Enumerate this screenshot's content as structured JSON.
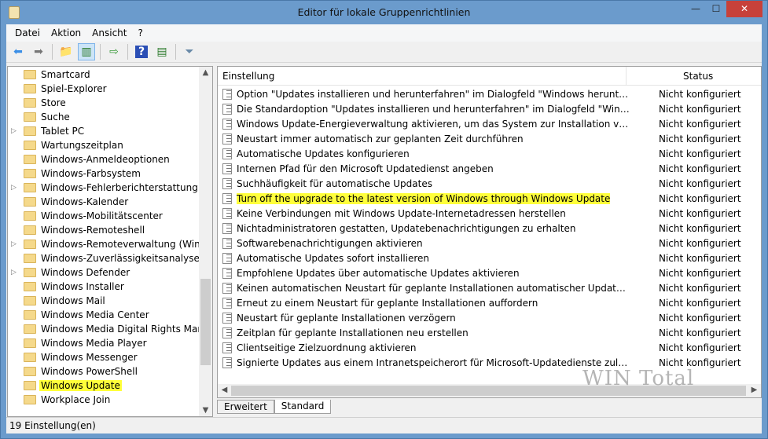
{
  "window": {
    "title": "Editor für lokale Gruppenrichtlinien",
    "minimize": "—",
    "maximize": "☐",
    "close": "✕"
  },
  "menu": [
    "Datei",
    "Aktion",
    "Ansicht",
    "?"
  ],
  "toolbar": [
    {
      "icon": "back-arrow-icon",
      "glyph": "⬅",
      "color": "#3a8ee6"
    },
    {
      "icon": "forward-arrow-icon",
      "glyph": "➡",
      "color": "#777"
    },
    {
      "icon": "up-folder-icon",
      "glyph": "📁",
      "color": "#d9b45a"
    },
    {
      "icon": "show-hide-tree-icon",
      "glyph": "▥",
      "color": "#2a7a2a",
      "active": true
    },
    {
      "icon": "export-list-icon",
      "glyph": "⇨",
      "color": "#3a9a3a"
    },
    {
      "icon": "help-icon",
      "glyph": "?",
      "color": "#fff"
    },
    {
      "icon": "action-pane-icon",
      "glyph": "▤",
      "color": "#2a7a2a"
    },
    {
      "icon": "filter-icon",
      "glyph": "⏷",
      "color": "#6a8aa8"
    }
  ],
  "tree": [
    {
      "label": "Smartcard"
    },
    {
      "label": "Spiel-Explorer"
    },
    {
      "label": "Store"
    },
    {
      "label": "Suche"
    },
    {
      "label": "Tablet PC",
      "expandable": true
    },
    {
      "label": "Wartungszeitplan"
    },
    {
      "label": "Windows-Anmeldeoptionen"
    },
    {
      "label": "Windows-Farbsystem"
    },
    {
      "label": "Windows-Fehlerberichterstattung",
      "expandable": true
    },
    {
      "label": "Windows-Kalender"
    },
    {
      "label": "Windows-Mobilitätscenter"
    },
    {
      "label": "Windows-Remoteshell"
    },
    {
      "label": "Windows-Remoteverwaltung (Window",
      "expandable": true
    },
    {
      "label": "Windows-Zuverlässigkeitsanalyse"
    },
    {
      "label": "Windows Defender",
      "expandable": true
    },
    {
      "label": "Windows Installer"
    },
    {
      "label": "Windows Mail"
    },
    {
      "label": "Windows Media Center"
    },
    {
      "label": "Windows Media Digital Rights Manage"
    },
    {
      "label": "Windows Media Player"
    },
    {
      "label": "Windows Messenger"
    },
    {
      "label": "Windows PowerShell"
    },
    {
      "label": "Windows Update",
      "selected": true
    },
    {
      "label": "Workplace Join"
    }
  ],
  "list": {
    "col_setting": "Einstellung",
    "col_status": "Status",
    "rows": [
      {
        "name": "Option \"Updates installieren und herunterfahren\" im Dialogfeld \"Windows herunterfahren\" nicht anzeigen",
        "status": "Nicht konfiguriert"
      },
      {
        "name": "Die Standardoption \"Updates installieren und herunterfahren\" im Dialogfeld \"Windows herunterfahren\" nicht anpassen",
        "status": "Nicht konfiguriert"
      },
      {
        "name": "Windows Update-Energieverwaltung aktivieren, um das System zur Installation von geplanten Updates zu reaktivieren",
        "status": "Nicht konfiguriert"
      },
      {
        "name": "Neustart immer automatisch zur geplanten Zeit durchführen",
        "status": "Nicht konfiguriert"
      },
      {
        "name": "Automatische Updates konfigurieren",
        "status": "Nicht konfiguriert"
      },
      {
        "name": "Internen Pfad für den Microsoft Updatedienst angeben",
        "status": "Nicht konfiguriert"
      },
      {
        "name": "Suchhäufigkeit für automatische Updates",
        "status": "Nicht konfiguriert"
      },
      {
        "name": "Turn off the upgrade to the latest version of Windows through Windows Update",
        "status": "Nicht konfiguriert",
        "highlighted": true
      },
      {
        "name": "Keine Verbindungen mit Windows Update-Internetadressen herstellen",
        "status": "Nicht konfiguriert"
      },
      {
        "name": "Nichtadministratoren gestatten, Updatebenachrichtigungen zu erhalten",
        "status": "Nicht konfiguriert"
      },
      {
        "name": "Softwarebenachrichtigungen aktivieren",
        "status": "Nicht konfiguriert"
      },
      {
        "name": "Automatische Updates sofort installieren",
        "status": "Nicht konfiguriert"
      },
      {
        "name": "Empfohlene Updates über automatische Updates aktivieren",
        "status": "Nicht konfiguriert"
      },
      {
        "name": "Keinen automatischen Neustart für geplante Installationen automatischer Updates durchführen",
        "status": "Nicht konfiguriert"
      },
      {
        "name": "Erneut zu einem Neustart für geplante Installationen auffordern",
        "status": "Nicht konfiguriert"
      },
      {
        "name": "Neustart für geplante Installationen verzögern",
        "status": "Nicht konfiguriert"
      },
      {
        "name": "Zeitplan für geplante Installationen neu erstellen",
        "status": "Nicht konfiguriert"
      },
      {
        "name": "Clientseitige Zielzuordnung aktivieren",
        "status": "Nicht konfiguriert"
      },
      {
        "name": "Signierte Updates aus einem Intranetspeicherort für Microsoft-Updatedienste zulassen",
        "status": "Nicht konfiguriert"
      }
    ]
  },
  "tabs": [
    {
      "label": "Erweitert"
    },
    {
      "label": "Standard",
      "active": true
    }
  ],
  "statusbar": "19 Einstellung(en)",
  "watermark": "WIN Total",
  "colors": {
    "highlight": "#ffff3a",
    "frame": "#6b9bcc",
    "close": "#c7413a"
  }
}
